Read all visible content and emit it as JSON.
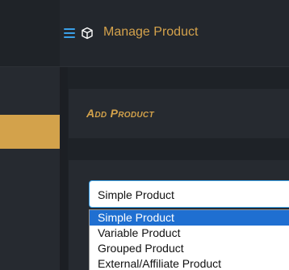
{
  "header": {
    "title": "Manage Product",
    "menu_icon": "hamburger-menu-icon",
    "page_icon": "cube-icon"
  },
  "card": {
    "title": "Add Product"
  },
  "product_type_select": {
    "value": "Simple Product",
    "options": [
      {
        "label": "Simple Product",
        "selected": true
      },
      {
        "label": "Variable Product",
        "selected": false
      },
      {
        "label": "Grouped Product",
        "selected": false
      },
      {
        "label": "External/Affiliate Product",
        "selected": false
      }
    ]
  },
  "colors": {
    "accent": "#d3a24b",
    "focus": "#3aa0e8",
    "selection": "#1f6fd1"
  }
}
